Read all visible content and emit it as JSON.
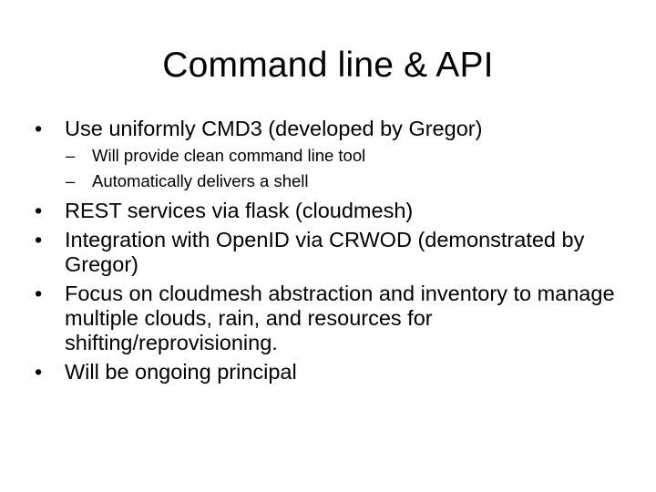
{
  "slide": {
    "title": "Command line & API",
    "bullet_marker": "•",
    "sub_marker": "–",
    "items": [
      {
        "text": "Use uniformly CMD3 (developed by Gregor)",
        "subitems": [
          "Will provide clean command line tool",
          "Automatically delivers a shell"
        ]
      },
      {
        "text": "REST services via flask (cloudmesh)"
      },
      {
        "text": "Integration with OpenID via CRWOD (demonstrated by Gregor)"
      },
      {
        "text": "Focus on cloudmesh abstraction and inventory to manage multiple clouds, rain, and resources for shifting/reprovisioning."
      },
      {
        "text": "Will be ongoing principal"
      }
    ]
  }
}
